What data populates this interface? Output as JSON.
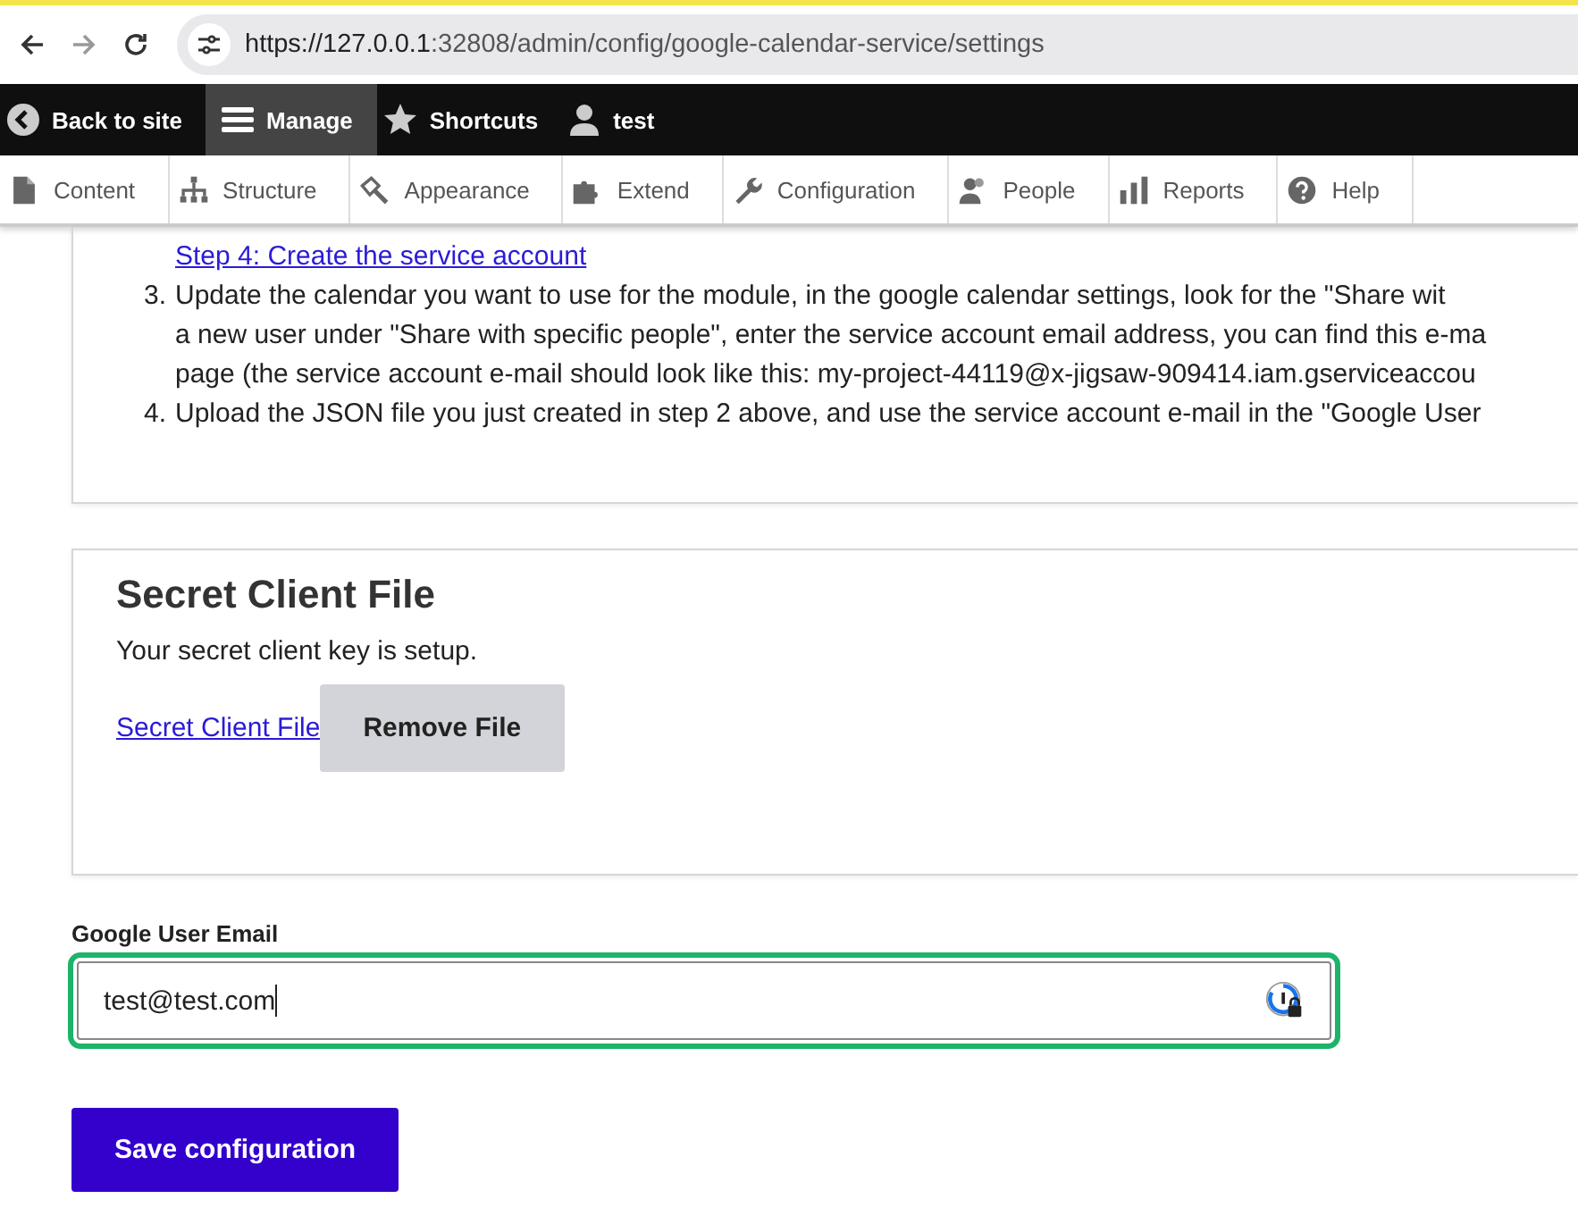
{
  "browser": {
    "url_host": "https://127.0.0.1",
    "url_rest": ":32808/admin/config/google-calendar-service/settings"
  },
  "toolbar": {
    "items": [
      {
        "label": "Back to site",
        "selected": false
      },
      {
        "label": "Manage",
        "selected": true
      },
      {
        "label": "Shortcuts",
        "selected": false
      },
      {
        "label": "test",
        "selected": false
      }
    ]
  },
  "admin_menu": [
    {
      "label": "Content"
    },
    {
      "label": "Structure"
    },
    {
      "label": "Appearance"
    },
    {
      "label": "Extend"
    },
    {
      "label": "Configuration"
    },
    {
      "label": "People"
    },
    {
      "label": "Reports"
    },
    {
      "label": "Help"
    }
  ],
  "instructions": {
    "link": "Step 4: Create the service account",
    "steps": [
      {
        "number": "3.",
        "lines": [
          "Update the calendar you want to use for the module, in the google calendar settings, look for the \"Share wit",
          "a new user under \"Share with specific people\", enter the service account email address, you can find this e-ma",
          "page (the service account e-mail should look like this: my-project-44119@x-jigsaw-909414.iam.gserviceaccou"
        ]
      },
      {
        "number": "4.",
        "lines": [
          "Upload the JSON file you just created in step 2 above, and use the service account e-mail in the \"Google User"
        ]
      }
    ]
  },
  "secret_client_file": {
    "title": "Secret Client File",
    "status": "Your secret client key is setup.",
    "file_link": "Secret Client File",
    "remove_button": "Remove File"
  },
  "email_field": {
    "label": "Google User Email",
    "value": "test@test.com"
  },
  "save_button": "Save configuration"
}
